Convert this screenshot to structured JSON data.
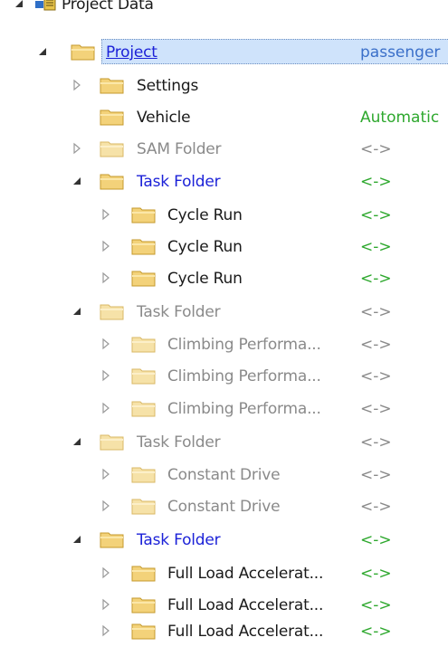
{
  "tree": {
    "root": {
      "label": "Project Data",
      "icon": "project-data-icon"
    },
    "project": {
      "label": "Project",
      "value": "passenger"
    },
    "settings": {
      "label": "Settings"
    },
    "vehicle": {
      "label": "Vehicle",
      "value": "Automatic"
    },
    "sam_folder": {
      "label": "SAM Folder",
      "value": "<->"
    },
    "task_folder_1": {
      "label": "Task Folder",
      "value": "<->",
      "children": [
        {
          "label": "Cycle Run",
          "value": "<->"
        },
        {
          "label": "Cycle Run",
          "value": "<->"
        },
        {
          "label": "Cycle Run",
          "value": "<->"
        }
      ]
    },
    "task_folder_2": {
      "label": "Task Folder",
      "value": "<->",
      "children": [
        {
          "label": "Climbing Performa...",
          "value": "<->"
        },
        {
          "label": "Climbing Performa...",
          "value": "<->"
        },
        {
          "label": "Climbing Performa...",
          "value": "<->"
        }
      ]
    },
    "task_folder_3": {
      "label": "Task Folder",
      "value": "<->",
      "children": [
        {
          "label": "Constant Drive",
          "value": "<->"
        },
        {
          "label": "Constant Drive",
          "value": "<->"
        }
      ]
    },
    "task_folder_4": {
      "label": "Task Folder",
      "value": "<->",
      "children": [
        {
          "label": "Full Load Accelerat...",
          "value": "<->"
        },
        {
          "label": "Full Load Accelerat...",
          "value": "<->"
        },
        {
          "label": "Full Load Accelerat...",
          "value": "<->"
        }
      ]
    }
  },
  "colors": {
    "selection": "#cfe3fb",
    "link_blue": "#1c22d8",
    "value_green": "#2ea82e",
    "disabled_gray": "#8a8a8a",
    "folder_yellow": "#f3d27a"
  }
}
